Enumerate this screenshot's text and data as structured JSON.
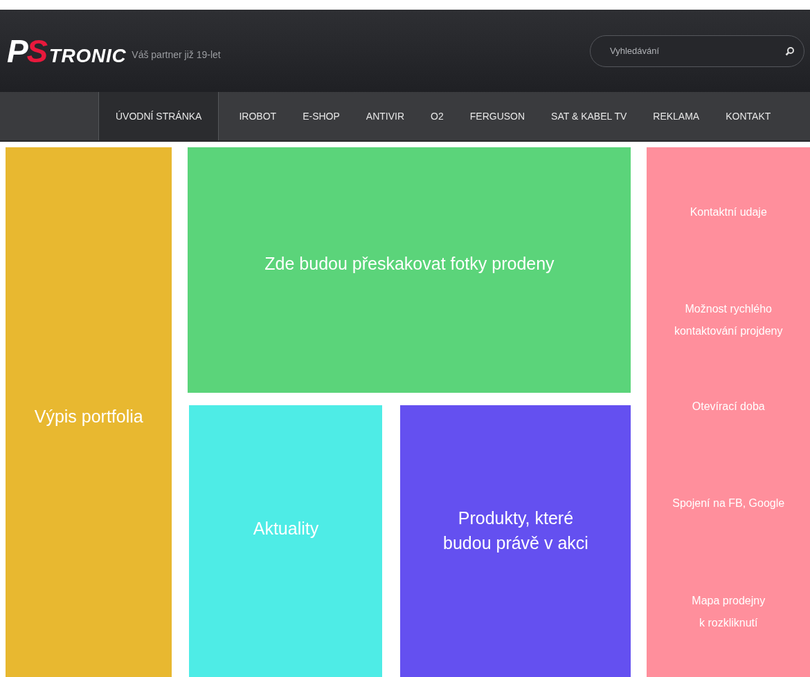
{
  "logo": {
    "parts": [
      {
        "text": "P",
        "kind": "mark",
        "color": "#ffffff"
      },
      {
        "text": "S",
        "kind": "mark",
        "color": "#e8193c"
      },
      {
        "text": "TRONIC",
        "kind": "word",
        "color": "#ffffff"
      }
    ],
    "tagline": "Váš partner již 19-let"
  },
  "search": {
    "placeholder": "Vyhledávání"
  },
  "nav": [
    {
      "label": "ÚVODNÍ STRÁNKA",
      "selected": true
    },
    {
      "label": "IROBOT",
      "selected": false
    },
    {
      "label": "E-SHOP",
      "selected": false
    },
    {
      "label": "ANTIVIR",
      "selected": false
    },
    {
      "label": "O2",
      "selected": false
    },
    {
      "label": "FERGUSON",
      "selected": false
    },
    {
      "label": "SAT & KABEL TV",
      "selected": false
    },
    {
      "label": "REKLAMA",
      "selected": false
    },
    {
      "label": "KONTAKT",
      "selected": false
    }
  ],
  "portfolio": {
    "text": "Výpis portfolia"
  },
  "slideshow": {
    "text": "Zde budou přeskakovat fotky prodeny"
  },
  "news": {
    "text": "Aktuality"
  },
  "offers": {
    "lines": [
      "Produkty, které",
      "budou právě v akci"
    ]
  },
  "contact": {
    "items": [
      {
        "lines": [
          "Kontaktní udaje"
        ]
      },
      {
        "lines": [
          "Možnost rychlého",
          "kontaktování projdeny"
        ]
      },
      {
        "lines": [
          "Otevírací doba"
        ]
      },
      {
        "lines": [
          "Spojení na FB, Google"
        ]
      },
      {
        "lines": [
          "Mapa prodejny",
          "k rozkliknutí"
        ]
      }
    ]
  }
}
